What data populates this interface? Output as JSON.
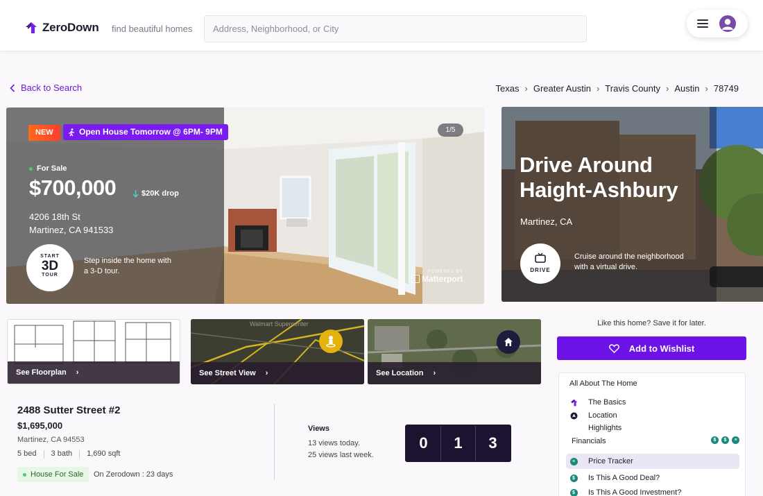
{
  "header": {
    "brand": "ZeroDown",
    "tagline": "find beautiful homes",
    "search_placeholder": "Address, Neighborhood, or City"
  },
  "nav": {
    "back_label": "Back to Search",
    "breadcrumbs": [
      "Texas",
      "Greater Austin",
      "Travis County",
      "Austin",
      "78749"
    ]
  },
  "hero": {
    "badge_new": "NEW",
    "badge_open_house": "Open House Tomorrow @ 6PM- 9PM",
    "photo_counter": "1/5",
    "status": "For Sale",
    "price": "$700,000",
    "price_drop": "$20K drop",
    "address_line1": "4206 18th St",
    "address_line2": "Martinez, CA 941533",
    "tour_top": "START",
    "tour_big": "3D",
    "tour_bottom": "TOUR",
    "tour_caption": "Step inside the home with a 3-D tour.",
    "powered_by": "POWERED BY",
    "matterport": "Matterport"
  },
  "drive": {
    "title": "Drive Around Haight-Ashbury",
    "city": "Martinez, CA",
    "button_label": "DRIVE",
    "caption": "Cruise around the neighborhood with a virtual drive."
  },
  "thumbnails": [
    {
      "label": "See Floorplan"
    },
    {
      "label": "See Street View",
      "map_text": "Walmart Supercenter"
    },
    {
      "label": "See Location"
    }
  ],
  "listing": {
    "title": "2488 Sutter Street #2",
    "price": "$1,695,000",
    "city": "Martinez, CA 94553",
    "beds": "5 bed",
    "baths": "3 bath",
    "sqft": "1,690 sqft",
    "status": "House For Sale",
    "on_zerodown": "On Zerodown : 23 days"
  },
  "views": {
    "title": "Views",
    "today": "13 views today.",
    "last_week": "25 views last week.",
    "digits": [
      "0",
      "1",
      "3"
    ]
  },
  "sidebar": {
    "save_hint": "Like this home? Save it for later.",
    "wishlist_label": "Add to Wishlist",
    "about_title": "All About The Home",
    "items": [
      {
        "label": "The Basics",
        "icon": "house-logo-icon"
      },
      {
        "label": "Location",
        "icon": "location-icon"
      },
      {
        "label": "Highlights",
        "icon": ""
      }
    ],
    "financials_label": "Financials",
    "financial_items": [
      {
        "label": "Price Tracker",
        "icon": "price-tracker-icon"
      },
      {
        "label": "Is This A Good Deal?",
        "icon": "dollar-coin-icon"
      },
      {
        "label": "Is This A Good Investment?",
        "icon": "dollar-coin-icon"
      }
    ]
  },
  "colors": {
    "brand_purple": "#6c12e6",
    "new_badge": "#ff4d22",
    "status_green": "#43d16b",
    "coin_teal": "#1a8a7a"
  }
}
